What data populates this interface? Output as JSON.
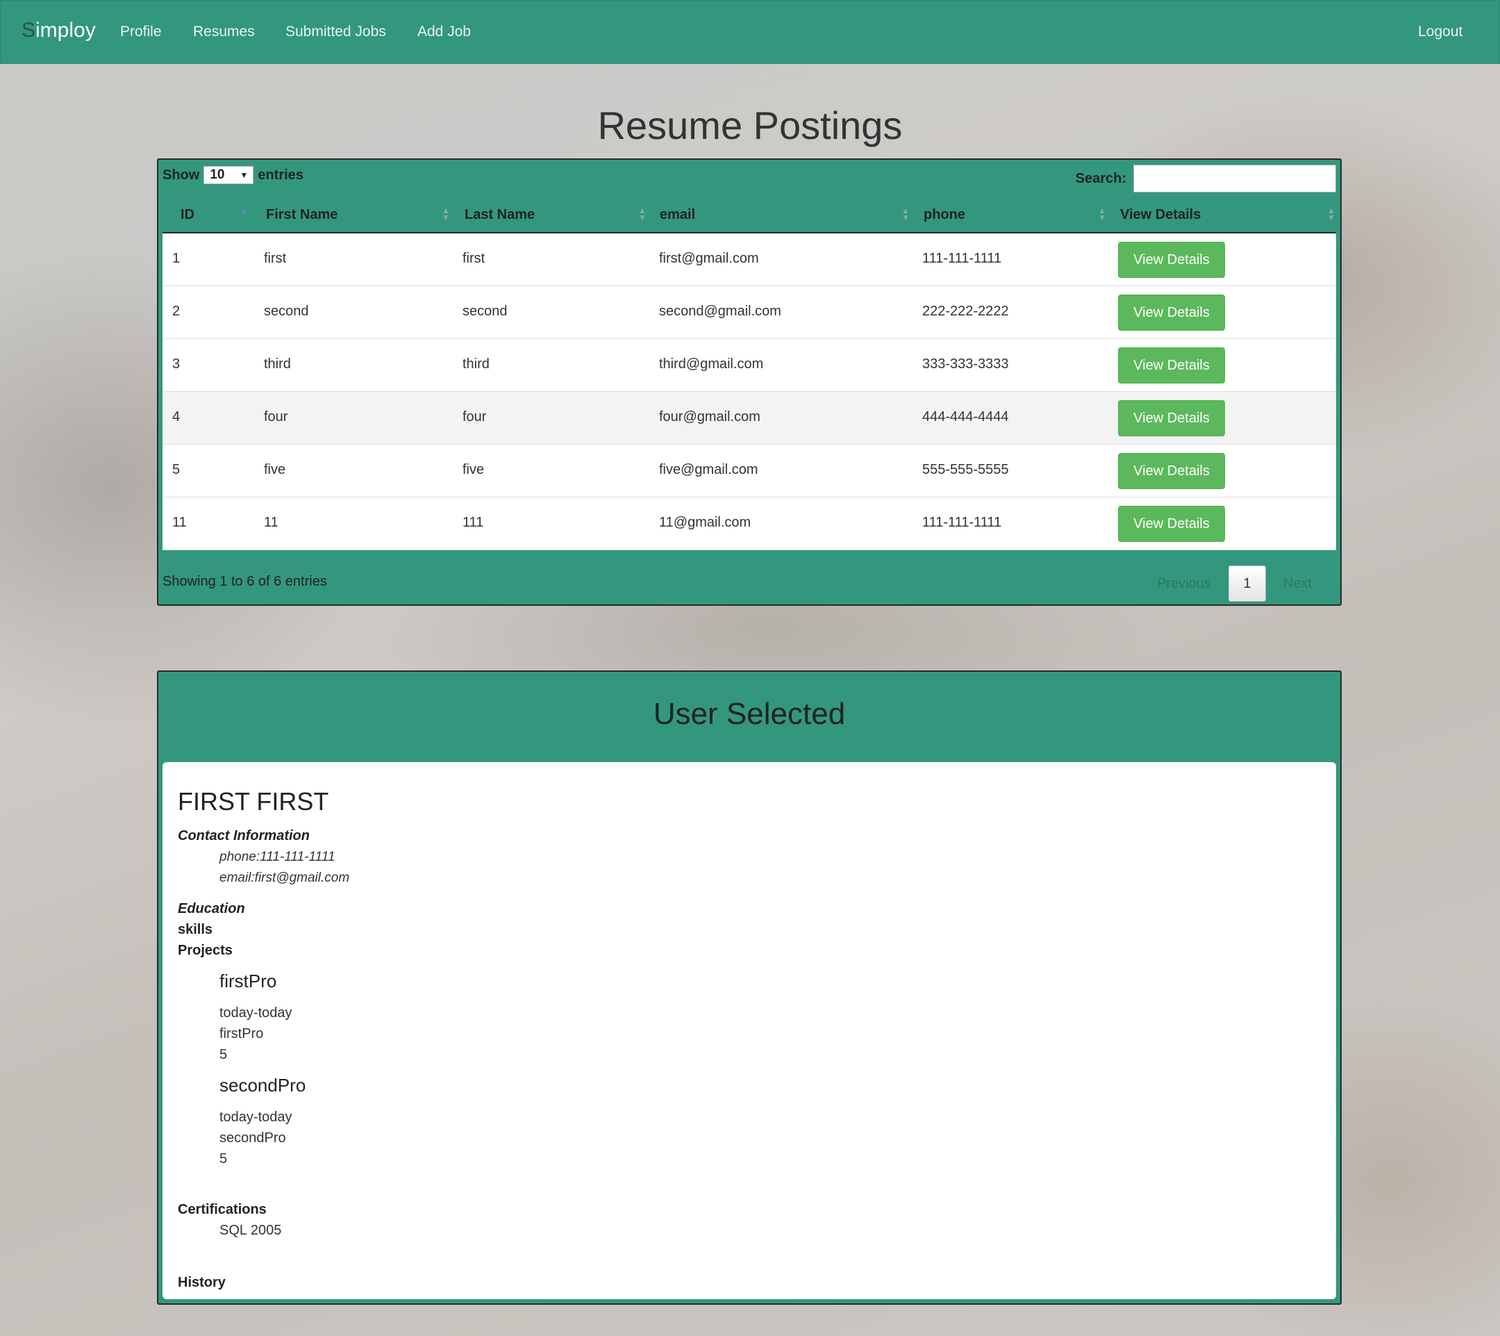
{
  "nav": {
    "brand_first": "S",
    "brand_rest": "imploy",
    "links": [
      "Profile",
      "Resumes",
      "Submitted Jobs",
      "Add Job"
    ],
    "logout": "Logout"
  },
  "page_title": "Resume Postings",
  "table_controls": {
    "show": "Show",
    "length_value": "10",
    "entries": "entries",
    "search_label": "Search:",
    "search_value": ""
  },
  "table": {
    "columns": [
      "ID",
      "First Name",
      "Last Name",
      "email",
      "phone",
      "View Details"
    ],
    "sorted_column": "ID",
    "rows": [
      {
        "id": "1",
        "first": "first",
        "last": "first",
        "email": "first@gmail.com",
        "phone": "111-111-1111",
        "action": "View Details"
      },
      {
        "id": "2",
        "first": "second",
        "last": "second",
        "email": "second@gmail.com",
        "phone": "222-222-2222",
        "action": "View Details"
      },
      {
        "id": "3",
        "first": "third",
        "last": "third",
        "email": "third@gmail.com",
        "phone": "333-333-3333",
        "action": "View Details"
      },
      {
        "id": "4",
        "first": "four",
        "last": "four",
        "email": "four@gmail.com",
        "phone": "444-444-4444",
        "action": "View Details"
      },
      {
        "id": "5",
        "first": "five",
        "last": "five",
        "email": "five@gmail.com",
        "phone": "555-555-5555",
        "action": "View Details"
      },
      {
        "id": "11",
        "first": "11",
        "last": "111",
        "email": "11@gmail.com",
        "phone": "111-111-1111",
        "action": "View Details"
      }
    ],
    "info": "Showing 1 to 6 of 6 entries",
    "pagination": {
      "previous": "Previous",
      "current": "1",
      "next": "Next"
    }
  },
  "selected": {
    "title": "User Selected",
    "name": "FIRST FIRST",
    "contact_heading": "Contact Information",
    "phone": "phone:111-111-1111",
    "email": "email:first@gmail.com",
    "education_heading": "Education",
    "skills_heading": "skills",
    "projects_heading": "Projects",
    "projects": [
      {
        "name": "firstPro",
        "dates": "today-today",
        "description": "firstPro",
        "value": "5"
      },
      {
        "name": "secondPro",
        "dates": "today-today",
        "description": "secondPro",
        "value": "5"
      }
    ],
    "certifications_heading": "Certifications",
    "certifications": [
      "SQL 2005"
    ],
    "history_heading": "History"
  },
  "colors": {
    "brand_green": "#33977d",
    "button_green": "#5cb85c"
  }
}
